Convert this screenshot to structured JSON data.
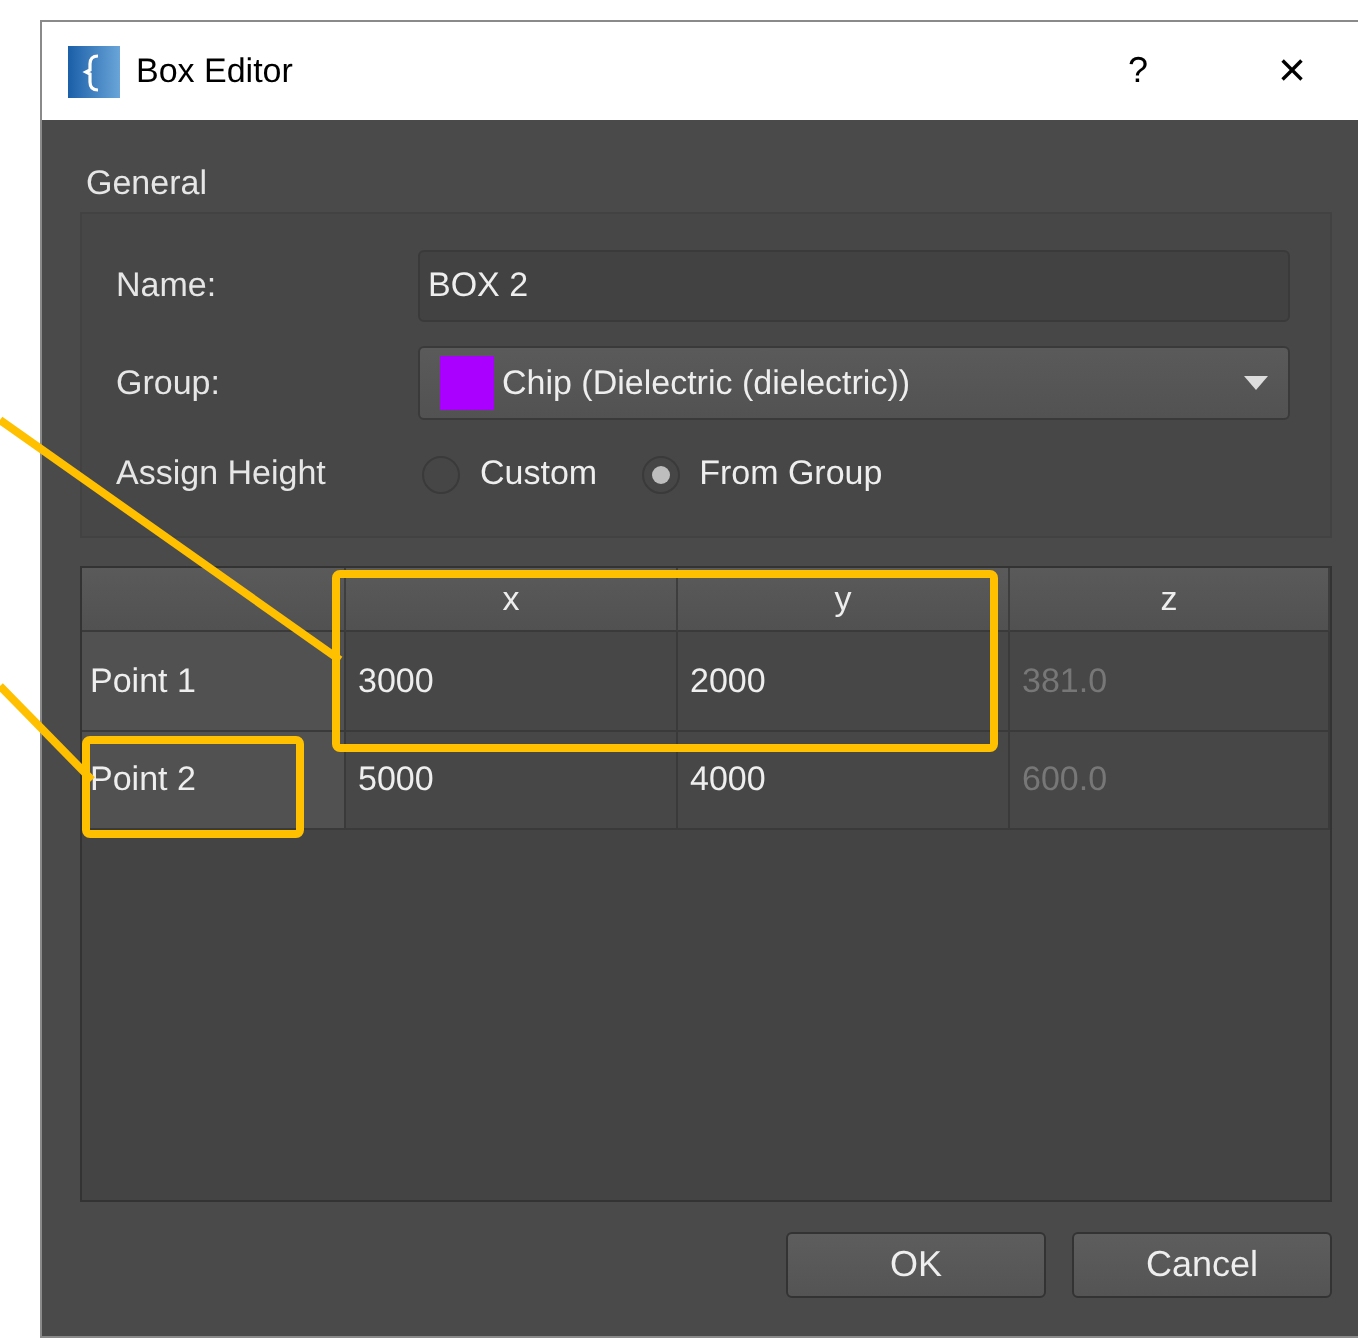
{
  "window": {
    "title": "Box Editor",
    "help": "?",
    "close": "×"
  },
  "general": {
    "title": "General",
    "name_label": "Name:",
    "name_value": "BOX 2",
    "group": {
      "label": "Group:",
      "value": "Chip (Dielectric (dielectric))",
      "color": "#aa00ff"
    },
    "height_label": "Assign Height",
    "height_options": [
      {
        "label": "Custom",
        "selected": false
      },
      {
        "label": "From Group",
        "selected": true
      }
    ]
  },
  "table": {
    "columns": [
      "x",
      "y",
      "z"
    ],
    "rows": [
      {
        "header": "Point 1",
        "cells": [
          {
            "text": "3000",
            "disabled": false
          },
          {
            "text": "2000",
            "disabled": false
          },
          {
            "text": "381.0",
            "disabled": true
          }
        ]
      },
      {
        "header": "Point 2",
        "cells": [
          {
            "text": "5000",
            "disabled": false
          },
          {
            "text": "4000",
            "disabled": false
          },
          {
            "text": "600.0",
            "disabled": true
          }
        ]
      }
    ]
  },
  "buttons": [
    "OK",
    "Cancel"
  ]
}
